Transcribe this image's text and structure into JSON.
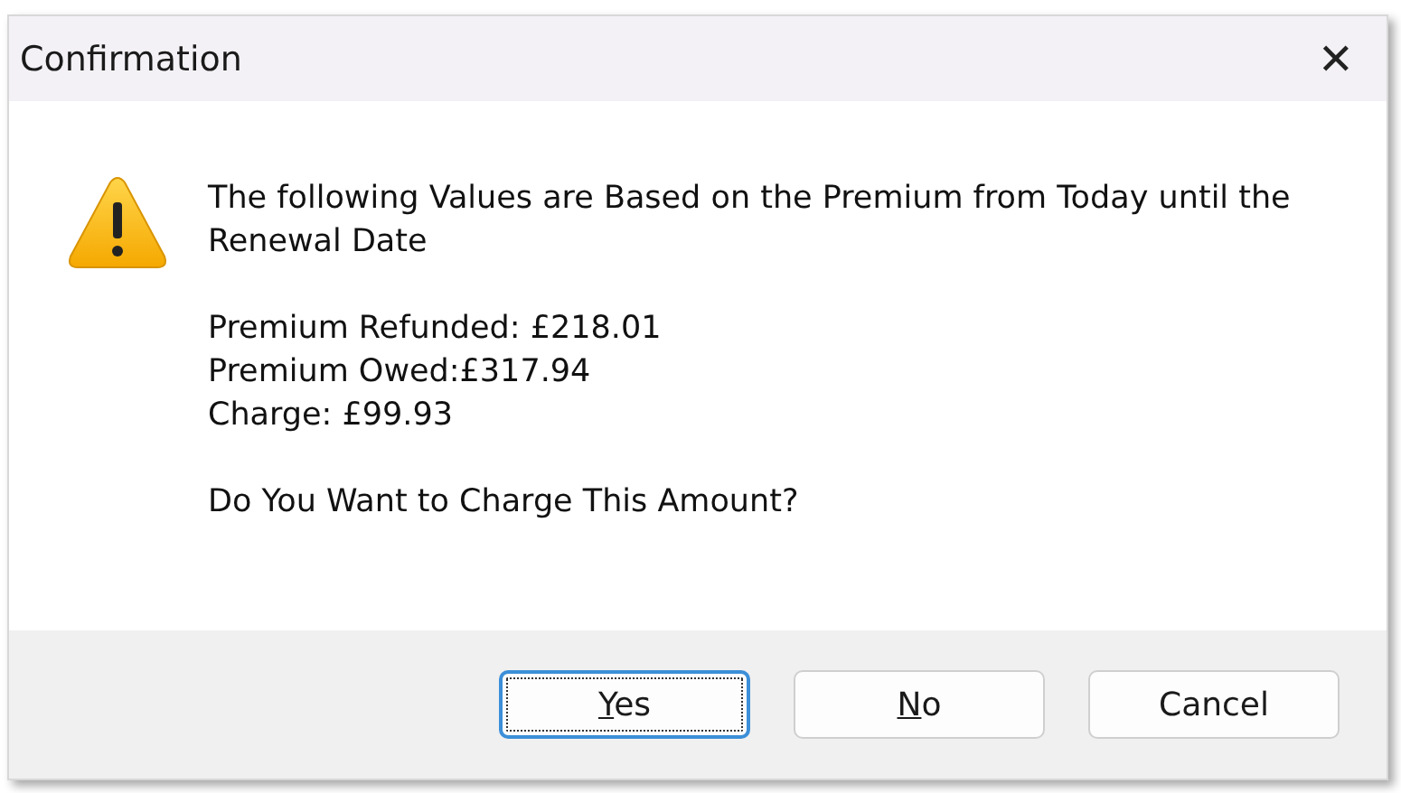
{
  "window": {
    "title": "Confirmation",
    "close": "✕"
  },
  "message": {
    "heading": "The following Values are Based on the Premium from Today until the Renewal Date",
    "details": [
      "Premium Refunded: £218.01",
      "Premium Owed:£317.94",
      "Charge: £99.93"
    ],
    "question": "Do You Want to Charge This Amount?"
  },
  "buttons": [
    {
      "label": "Yes",
      "focused": true,
      "mnemonic": true
    },
    {
      "label": "No",
      "focused": false,
      "mnemonic": true
    },
    {
      "label": "Cancel",
      "focused": false,
      "mnemonic": false
    }
  ]
}
